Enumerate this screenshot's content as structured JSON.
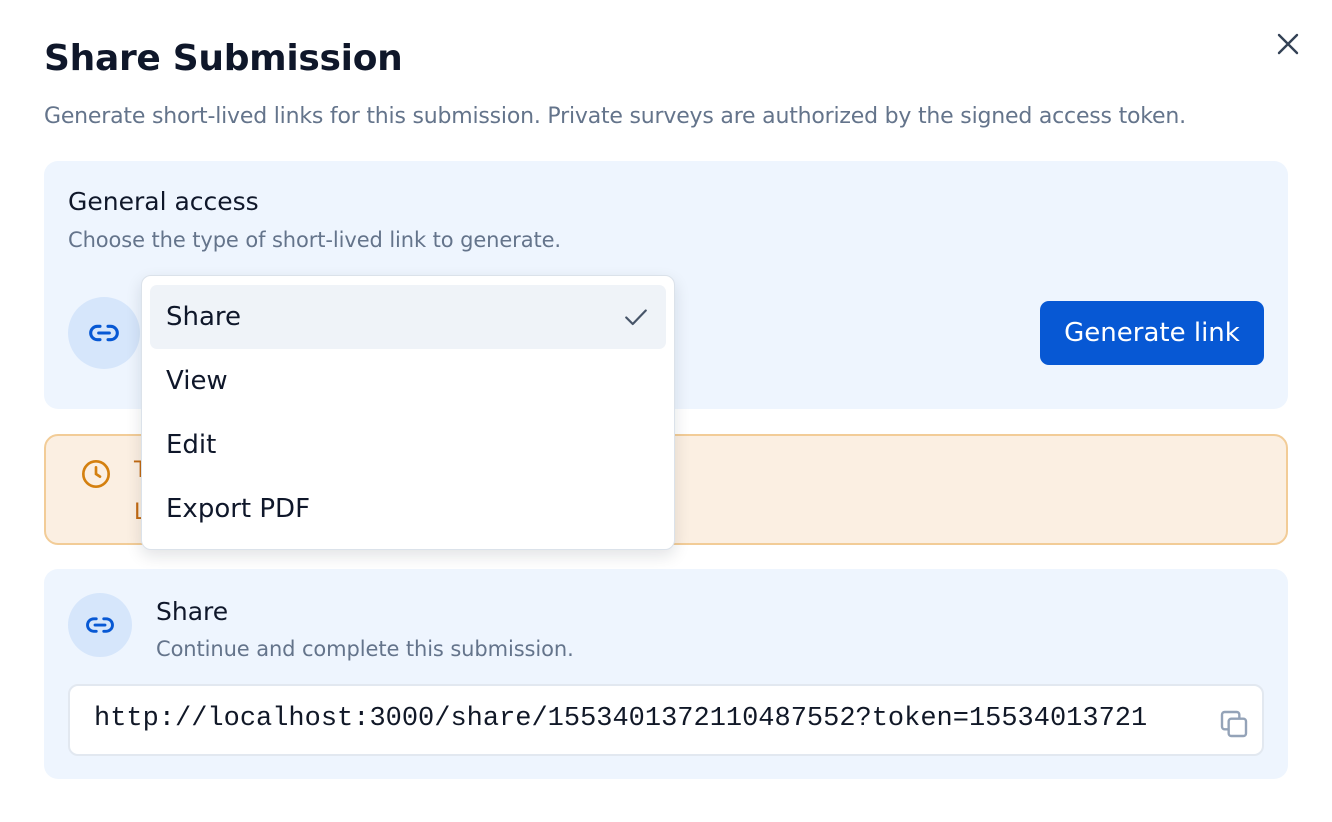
{
  "dialog": {
    "title": "Share Submission",
    "description": "Generate short-lived links for this submission. Private surveys are authorized by the signed access token."
  },
  "access": {
    "title": "General access",
    "subtitle": "Choose the type of short-lived link to generate.",
    "link_icon": "link-icon",
    "generate_label": "Generate link"
  },
  "dropdown": {
    "options": [
      {
        "label": "Share",
        "selected": true
      },
      {
        "label": "View",
        "selected": false
      },
      {
        "label": "Edit",
        "selected": false
      },
      {
        "label": "Export PDF",
        "selected": false
      }
    ],
    "check_icon": "check-icon"
  },
  "warning": {
    "icon": "clock-icon",
    "line1_fragment": "T",
    "line2_fragment": "L"
  },
  "share_link": {
    "title": "Share",
    "subtitle": "Continue and complete this submission.",
    "url": "http://localhost:3000/share/1553401372110487552?token=15534013721",
    "link_icon": "link-icon",
    "copy_icon": "copy-icon"
  },
  "colors": {
    "primary": "#0758d4",
    "panel_bg": "#eef5fe",
    "warning_bg": "#fbefe2",
    "warning_border": "#f2cc97",
    "warning_text": "#c26a12",
    "muted_text": "#64748b"
  }
}
